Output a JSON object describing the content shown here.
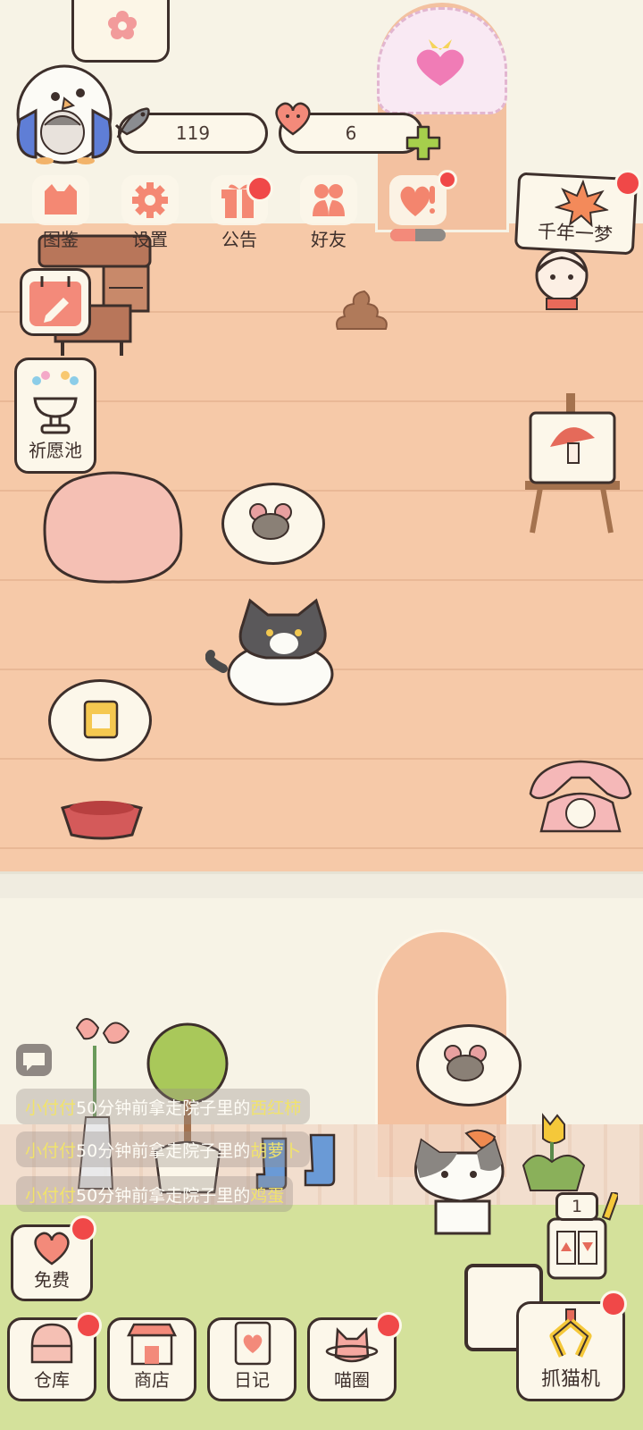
{
  "stats": {
    "fish_count": "119",
    "heart_count": "6"
  },
  "menu": {
    "items": [
      {
        "label": "图鉴",
        "icon": "cat-book-icon",
        "badge": false
      },
      {
        "label": "设置",
        "icon": "gear-icon",
        "badge": false
      },
      {
        "label": "公告",
        "icon": "gift-icon",
        "badge": true
      },
      {
        "label": "好友",
        "icon": "friends-icon",
        "badge": false
      },
      {
        "label": "",
        "icon": "heart-alert-icon",
        "badge": true
      }
    ]
  },
  "side": {
    "wish_label": "祈愿池",
    "event_label": "千年一梦"
  },
  "messages": [
    {
      "who": "小付付",
      "text": "50分钟前拿走院子里的",
      "item": "西红柿"
    },
    {
      "who": "小付付",
      "text": "50分钟前拿走院子里的",
      "item": "胡萝卜"
    },
    {
      "who": "小付付",
      "text": "50分钟前拿走院子里的",
      "item": "鸡蛋"
    }
  ],
  "yard": {
    "slot_count": "1"
  },
  "bottom": {
    "free_label": "免费",
    "warehouse_label": "仓库",
    "shop_label": "商店",
    "diary_label": "日记",
    "circle_label": "喵圈",
    "claw_label": "抓猫机"
  },
  "colors": {
    "badge": "#f04848",
    "floor": "#f6c9a8",
    "grass": "#d4e19b",
    "outline": "#3d2f2b"
  }
}
